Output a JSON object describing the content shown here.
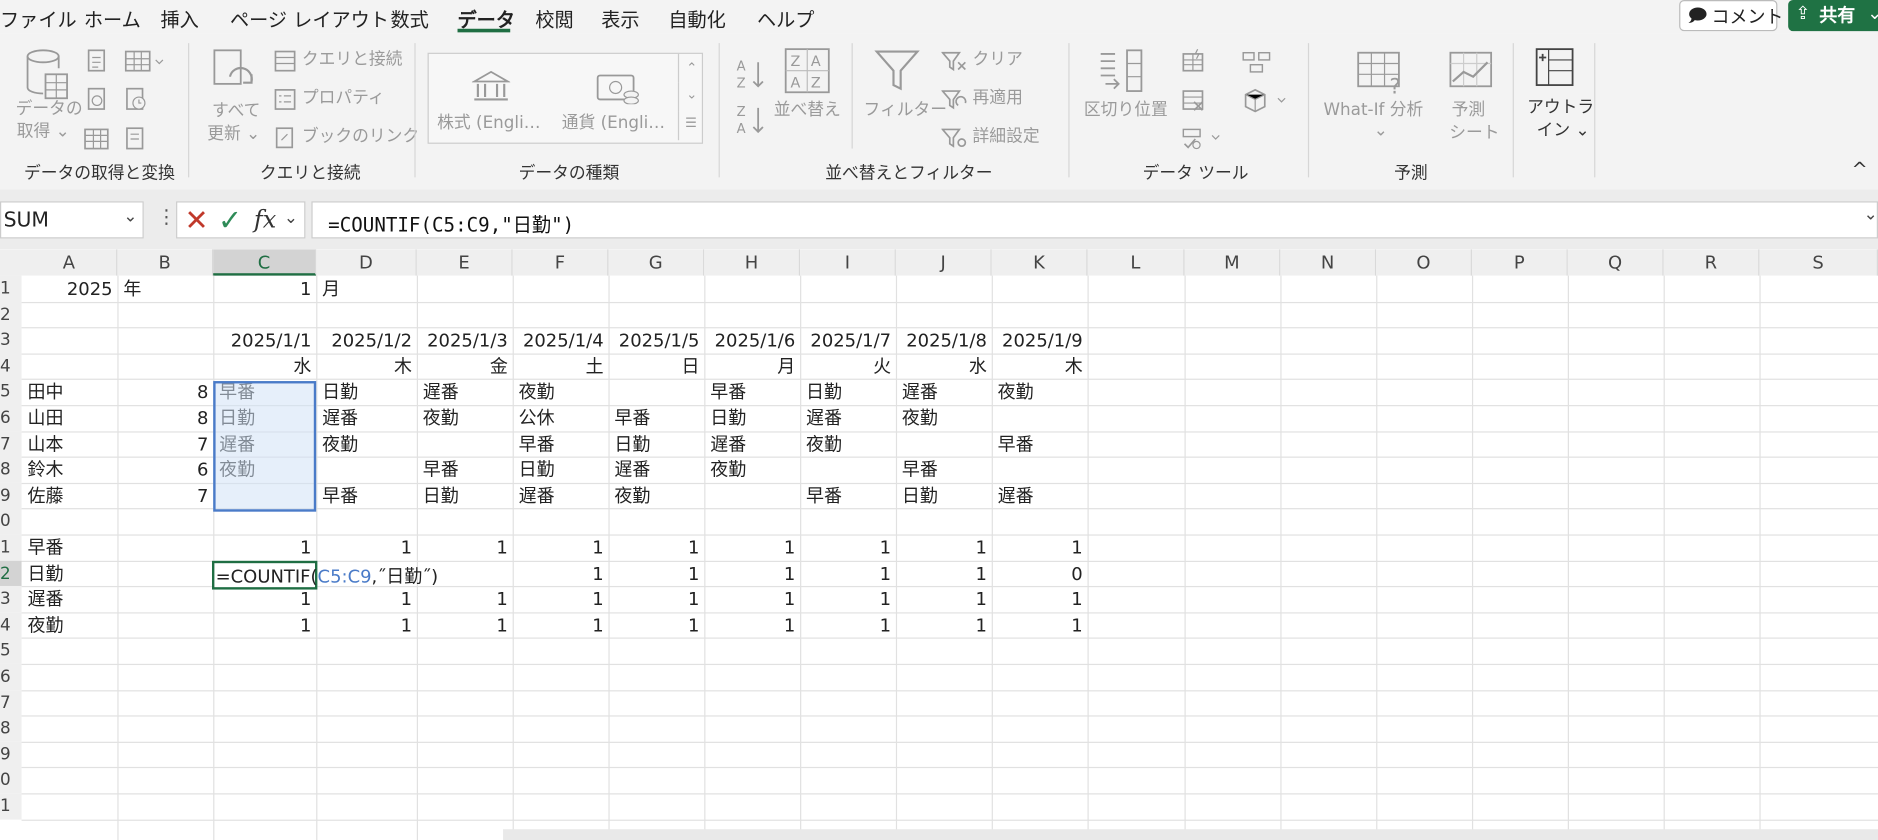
{
  "menu": {
    "tabs": [
      "ファイル",
      "ホーム",
      "挿入",
      "ページ レイアウト",
      "数式",
      "データ",
      "校閲",
      "表示",
      "自動化",
      "ヘルプ"
    ],
    "active": "データ",
    "comment_label": "コメント",
    "share_label": "共有"
  },
  "ribbon": {
    "groups": {
      "get_data": "データの取得と変換",
      "queries": "クエリと接続",
      "data_types": "データの種類",
      "sort_filter": "並べ替えとフィルター",
      "data_tools": "データ ツール",
      "forecast": "予測"
    },
    "get_data": {
      "btn_line1": "データの",
      "btn_line2": "取得 ⌄"
    },
    "queries": {
      "refresh_line1": "すべて",
      "refresh_line2": "更新 ⌄",
      "queries_connections": "クエリと接続",
      "properties": "プロパティ",
      "edit_links": "ブックのリンク"
    },
    "data_types": {
      "stocks": "株式 (Engli…",
      "currency": "通貨 (Engli…"
    },
    "sort_filter": {
      "sort": "並べ替え",
      "filter": "フィルター",
      "clear": "クリア",
      "reapply": "再適用",
      "advanced": "詳細設定"
    },
    "data_tools": {
      "text_to_columns": "区切り位置"
    },
    "forecast": {
      "whatif": "What-If 分析",
      "whatif_chev": "⌄",
      "sheet_line1": "予測",
      "sheet_line2": "シート"
    },
    "outline": {
      "line1": "アウトラ",
      "line2": "イン ⌄"
    }
  },
  "formula_bar": {
    "name_box": "SUM",
    "formula": "=COUNTIF(C5:C9,\"日勤\")"
  },
  "sheet": {
    "columns": [
      "A",
      "B",
      "C",
      "D",
      "E",
      "F",
      "G",
      "H",
      "I",
      "J",
      "K",
      "L",
      "M",
      "N",
      "O",
      "P",
      "Q",
      "R",
      "S"
    ],
    "row_numbers": [
      "1",
      "2",
      "3",
      "4",
      "5",
      "6",
      "7",
      "8",
      "9",
      "0",
      "1",
      "2",
      "3",
      "4",
      "5",
      "6",
      "7",
      "8",
      "9",
      "0",
      "1"
    ],
    "year": "2025",
    "year_unit": "年",
    "month": "1",
    "month_unit": "月",
    "dates": [
      "2025/1/1",
      "2025/1/2",
      "2025/1/3",
      "2025/1/4",
      "2025/1/5",
      "2025/1/6",
      "2025/1/7",
      "2025/1/8",
      "2025/1/9"
    ],
    "weekdays": [
      "水",
      "木",
      "金",
      "土",
      "日",
      "月",
      "火",
      "水",
      "木"
    ],
    "staff": [
      {
        "name": "田中",
        "count": "8",
        "shifts": [
          "早番",
          "日勤",
          "遅番",
          "夜勤",
          "",
          "早番",
          "日勤",
          "遅番",
          "夜勤"
        ]
      },
      {
        "name": "山田",
        "count": "8",
        "shifts": [
          "日勤",
          "遅番",
          "夜勤",
          "公休",
          "早番",
          "日勤",
          "遅番",
          "夜勤",
          ""
        ]
      },
      {
        "name": "山本",
        "count": "7",
        "shifts": [
          "遅番",
          "夜勤",
          "",
          "早番",
          "日勤",
          "遅番",
          "夜勤",
          "",
          "早番"
        ]
      },
      {
        "name": "鈴木",
        "count": "6",
        "shifts": [
          "夜勤",
          "",
          "早番",
          "日勤",
          "遅番",
          "夜勤",
          "",
          "早番",
          ""
        ]
      },
      {
        "name": "佐藤",
        "count": "7",
        "shifts": [
          "",
          "早番",
          "日勤",
          "遅番",
          "夜勤",
          "",
          "早番",
          "日勤",
          "遅番"
        ]
      }
    ],
    "summary": [
      {
        "label": "早番",
        "values": [
          "1",
          "1",
          "1",
          "1",
          "1",
          "1",
          "1",
          "1",
          "1"
        ]
      },
      {
        "label": "日勤",
        "values": [
          "",
          "",
          "",
          "1",
          "1",
          "1",
          "1",
          "1",
          "0"
        ]
      },
      {
        "label": "遅番",
        "values": [
          "1",
          "1",
          "1",
          "1",
          "1",
          "1",
          "1",
          "1",
          "1"
        ]
      },
      {
        "label": "夜勤",
        "values": [
          "1",
          "1",
          "1",
          "1",
          "1",
          "1",
          "1",
          "1",
          "1"
        ]
      }
    ],
    "editing": {
      "fn": "=COUNTIF(",
      "ref": "C5:C9",
      "rest": ",˝日勤˝)"
    }
  }
}
